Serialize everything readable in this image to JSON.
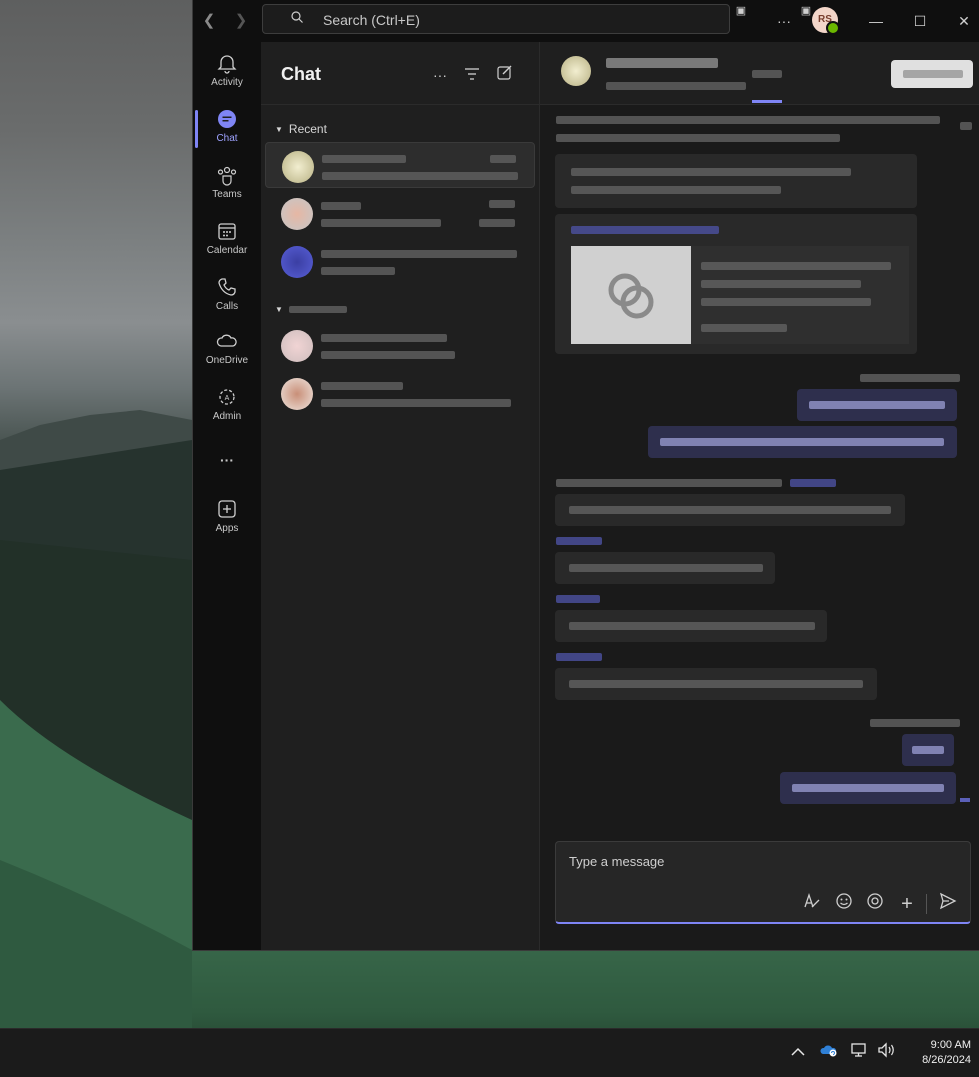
{
  "titlebar": {
    "search_placeholder": "Search (Ctrl+E)",
    "more_label": "···",
    "avatar_initials": "RS",
    "minimize": "—",
    "maximize": "☐",
    "close": "✕"
  },
  "rail": [
    {
      "label": "Activity",
      "icon": "bell-icon"
    },
    {
      "label": "Chat",
      "icon": "chat-icon",
      "active": true
    },
    {
      "label": "Teams",
      "icon": "teams-icon"
    },
    {
      "label": "Calendar",
      "icon": "calendar-icon"
    },
    {
      "label": "Calls",
      "icon": "phone-icon"
    },
    {
      "label": "OneDrive",
      "icon": "cloud-icon"
    },
    {
      "label": "Admin",
      "icon": "admin-icon"
    },
    {
      "label": "···",
      "icon": "more-icon"
    },
    {
      "label": "Apps",
      "icon": "apps-icon"
    }
  ],
  "chatlist": {
    "title": "Chat",
    "section_recent": "Recent"
  },
  "compose": {
    "placeholder": "Type a message"
  },
  "taskbar": {
    "time": "9:00 AM",
    "date": "8/26/2024"
  },
  "colors": {
    "accent": "#7f85f5",
    "rail_bg": "#0f0f0f",
    "pane_bg": "#1f1f1f",
    "bubble_out": "#2e2f4d",
    "bubble_in": "#292929"
  }
}
